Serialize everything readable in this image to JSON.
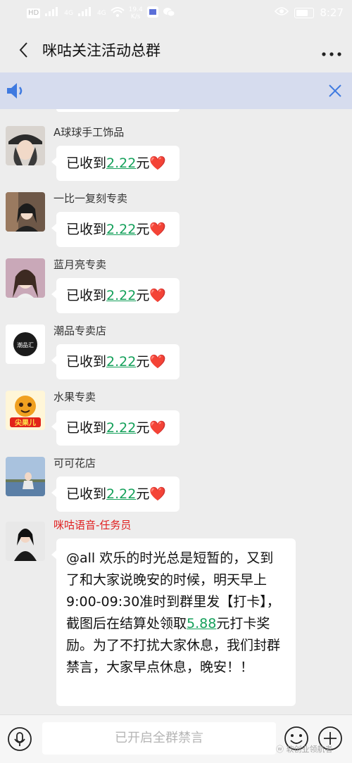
{
  "status_bar": {
    "network": "HD",
    "signal1": "4G",
    "signal2": "4G",
    "speed": "19.4",
    "speed_unit": "K/s",
    "time": "8:27"
  },
  "header": {
    "title": "咪咕关注活动总群"
  },
  "messages": [
    {
      "sender": "A球球手工饰品",
      "prefix": "已收到",
      "amount": "2.22",
      "suffix": "元",
      "heart": "❤️"
    },
    {
      "sender": "一比一复刻专卖",
      "prefix": "已收到",
      "amount": "2.22",
      "suffix": "元",
      "heart": "❤️"
    },
    {
      "sender": "蓝月亮专卖",
      "prefix": "已收到",
      "amount": "2.22",
      "suffix": "元",
      "heart": "❤️"
    },
    {
      "sender": "潮品专卖店",
      "prefix": "已收到",
      "amount": "2.22",
      "suffix": "元",
      "heart": "❤️"
    },
    {
      "sender": "水果专卖",
      "prefix": "已收到",
      "amount": "2.22",
      "suffix": "元",
      "heart": "❤️"
    },
    {
      "sender": "可可花店",
      "prefix": "已收到",
      "amount": "2.22",
      "suffix": "元",
      "heart": "❤️"
    }
  ],
  "long_message": {
    "sender": "咪咕语音-任务员",
    "text_before": "@all 欢乐的时光总是短暂的，又到了和大家说晚安的时候，明天早上9:00-09:30准时到群里发【打卡】，截图后在结算处领取",
    "amount": "5.88",
    "text_after": "元打卡奖励。为了不打扰大家休息，我们封群禁言，大家早点休息，晚安！！"
  },
  "avatars": {
    "fruit_badge": "尖果儿",
    "shop_logo": "潮品汇"
  },
  "input_bar": {
    "muted_text": "已开启全群禁言",
    "watermark": "软创业领航者"
  },
  "colors": {
    "amount": "#14a05a",
    "heart": "#e1252c",
    "sender_highlight": "#e02020",
    "notice_bar": "#d6dcee"
  }
}
